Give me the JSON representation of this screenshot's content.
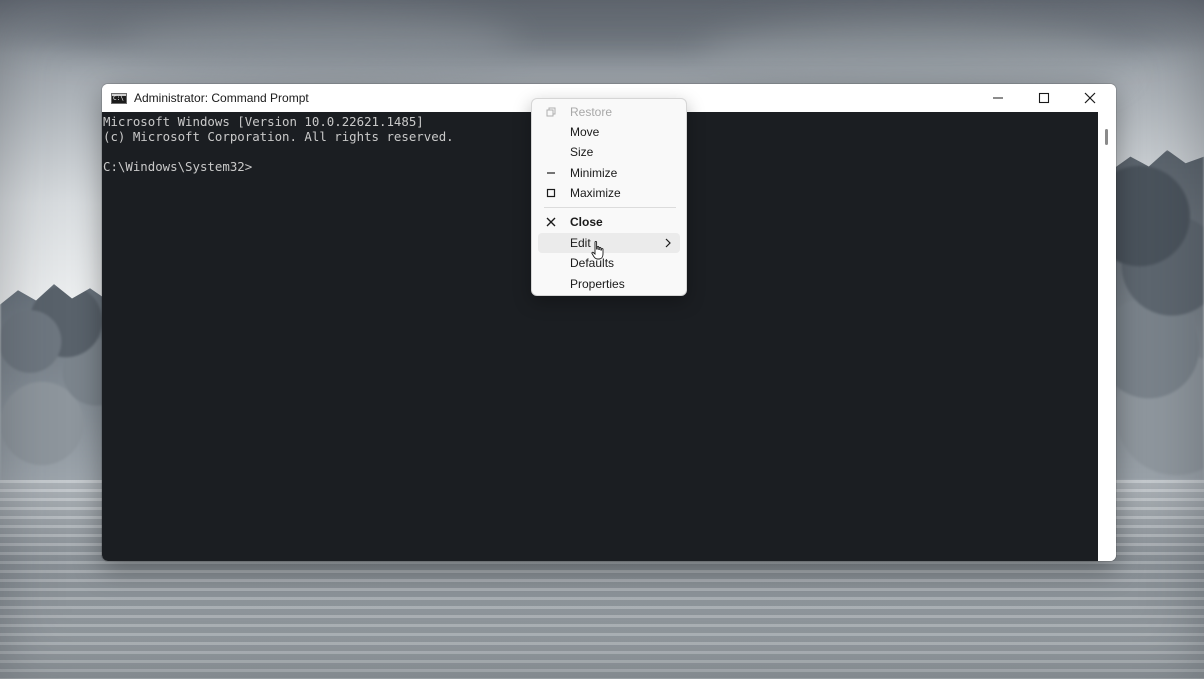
{
  "window": {
    "title": "Administrator: Command Prompt",
    "icon": "cmd-icon",
    "controls": {
      "minimize_icon": "minimize-icon",
      "maximize_icon": "maximize-icon",
      "close_icon": "close-icon"
    }
  },
  "console": {
    "lines": [
      "Microsoft Windows [Version 10.0.22621.1485]",
      "(c) Microsoft Corporation. All rights reserved.",
      "C:\\Windows\\System32>"
    ],
    "background": "#1b1e22",
    "text_color": "#c9c9c9"
  },
  "system_menu": {
    "items": [
      {
        "label": "Restore",
        "icon": "restore-icon",
        "enabled": false
      },
      {
        "label": "Move",
        "icon": "",
        "enabled": true
      },
      {
        "label": "Size",
        "icon": "",
        "enabled": true
      },
      {
        "label": "Minimize",
        "icon": "minimize-icon",
        "enabled": true
      },
      {
        "label": "Maximize",
        "icon": "maximize-icon",
        "enabled": true
      },
      {
        "label": "Close",
        "icon": "close-icon",
        "enabled": true,
        "bold": true
      },
      {
        "label": "Edit",
        "icon": "",
        "enabled": true,
        "submenu": true,
        "hovered": true
      },
      {
        "label": "Defaults",
        "icon": "",
        "enabled": true
      },
      {
        "label": "Properties",
        "icon": "",
        "enabled": true
      }
    ]
  }
}
